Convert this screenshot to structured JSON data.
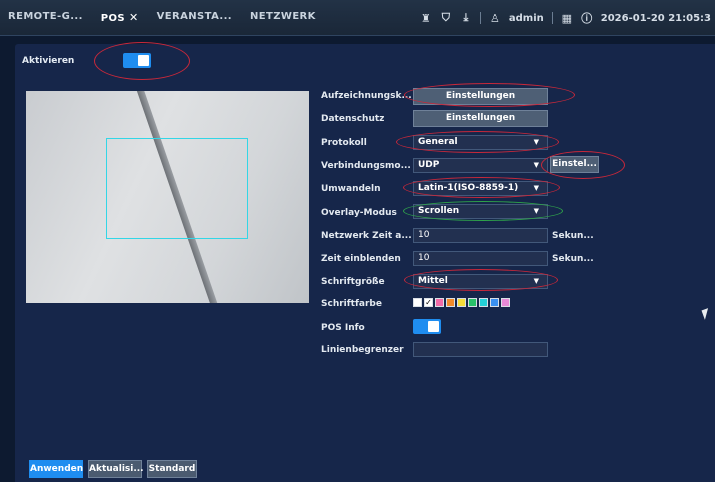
{
  "header": {
    "tabs": [
      {
        "label": "REMOTE-G..."
      },
      {
        "label": "POS",
        "close": "✕"
      },
      {
        "label": "VERANSTA..."
      },
      {
        "label": "NETZWERK"
      }
    ],
    "user": "admin",
    "datetime": "2026-01-20 21:05:3"
  },
  "aktivieren": {
    "label": "Aktivieren",
    "on": true
  },
  "form": {
    "aufzeichnung": {
      "label": "Aufzeichnungsk...",
      "button": "Einstellungen"
    },
    "datenschutz": {
      "label": "Datenschutz",
      "button": "Einstellungen"
    },
    "protokoll": {
      "label": "Protokoll",
      "value": "General"
    },
    "verbindung": {
      "label": "Verbindungsmo...",
      "value": "UDP",
      "button": "Einstel..."
    },
    "umwandeln": {
      "label": "Umwandeln",
      "value": "Latin-1(ISO-8859-1)"
    },
    "overlay": {
      "label": "Overlay-Modus",
      "value": "Scrollen"
    },
    "netzwerk_zeit": {
      "label": "Netzwerk Zeit a...",
      "value": "10",
      "unit": "Sekun..."
    },
    "zeit_einblenden": {
      "label": "Zeit einblenden",
      "value": "10",
      "unit": "Sekun..."
    },
    "schriftgroesse": {
      "label": "Schriftgröße",
      "value": "Mittel"
    },
    "schriftfarbe": {
      "label": "Schriftfarbe",
      "colors": [
        "#ffffff",
        "#ffffff",
        "#f06aa8",
        "#f08a2a",
        "#f4dc3a",
        "#29c26a",
        "#24d0d8",
        "#3a90f0",
        "#e88ad8"
      ]
    },
    "pos_info": {
      "label": "POS Info",
      "on": true
    },
    "linienbegrenzer": {
      "label": "Linienbegrenzer",
      "value": ""
    }
  },
  "footer": {
    "apply": "Anwenden",
    "refresh": "Aktualisi...",
    "default": "Standard"
  },
  "colors": {
    "accent": "#1f8df0",
    "annotation_red": "#c8283a",
    "annotation_green": "#2fa34a"
  }
}
